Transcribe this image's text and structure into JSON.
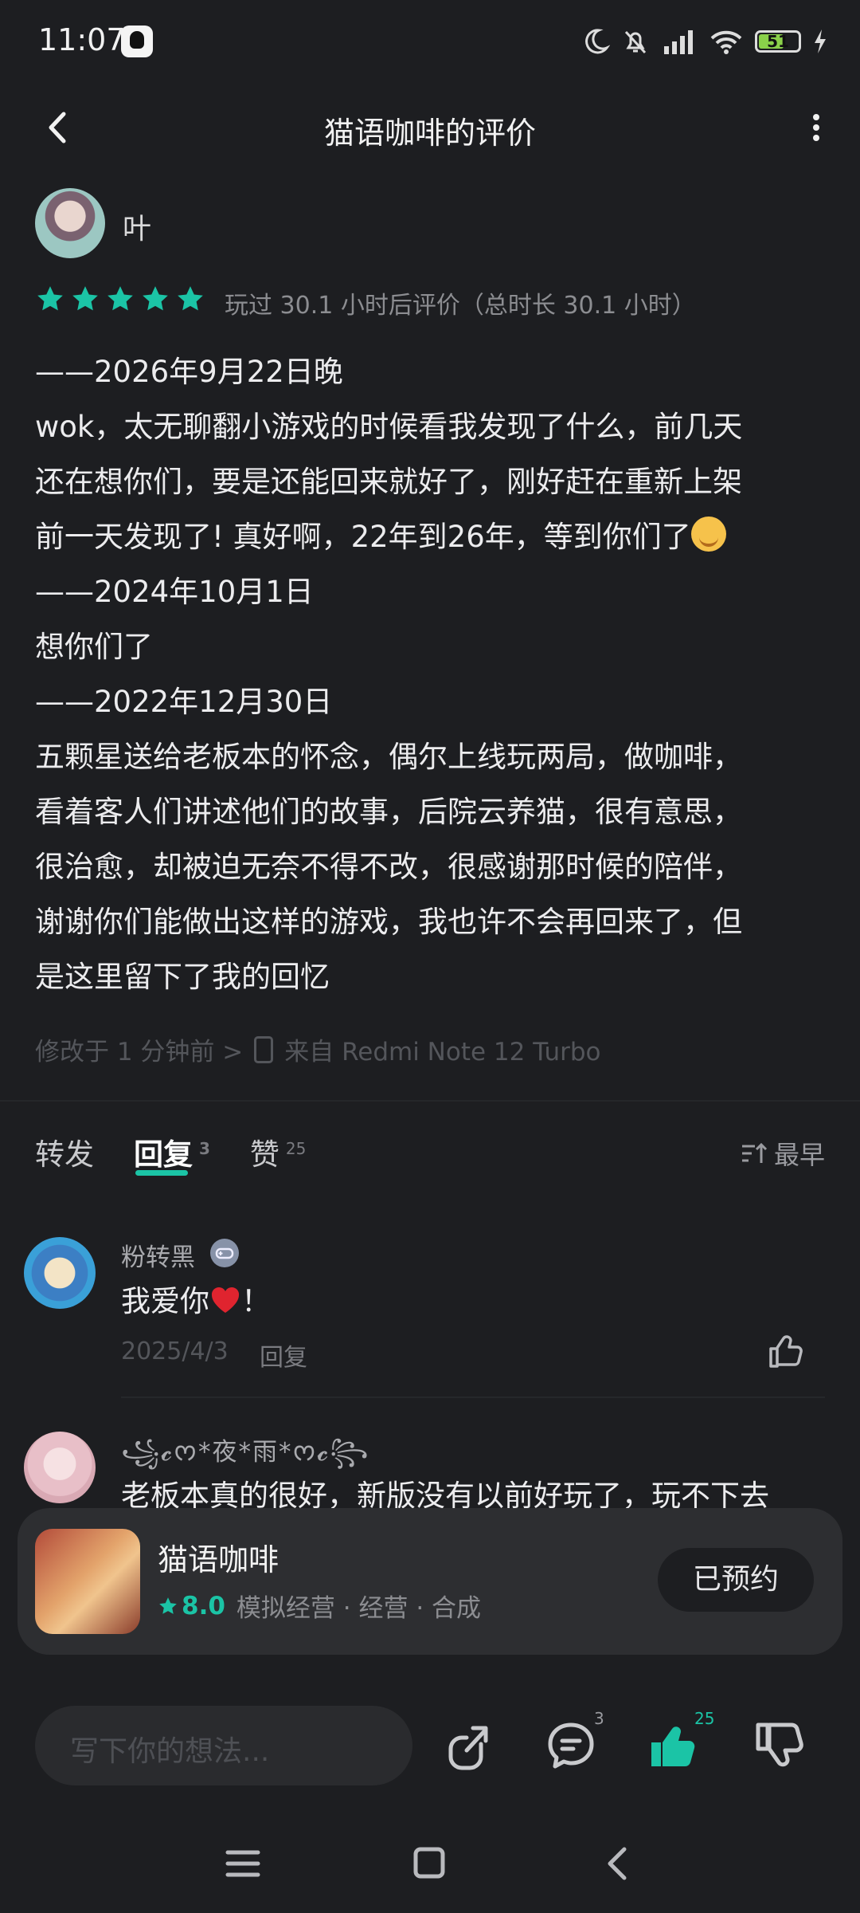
{
  "status_bar": {
    "time": "11:07",
    "battery": "51"
  },
  "header": {
    "title": "猫语咖啡的评价"
  },
  "review": {
    "user": "叶",
    "stars": 5,
    "playtime": "玩过 30.1 小时后评价（总时长 30.1 小时）",
    "lines": [
      "——2026年9月22日晚",
      "wok，太无聊翻小游戏的时候看我发现了什么，前几天",
      "还在想你们，要是还能回来就好了，刚好赶在重新上架",
      "前一天发现了! 真好啊，22年到26年，等到你们了",
      "——2024年10月1日",
      "想你们了",
      "——2022年12月30日",
      "五颗星送给老板本的怀念，偶尔上线玩两局，做咖啡，",
      "看着客人们讲述他们的故事，后院云养猫，很有意思，",
      "很治愈，却被迫无奈不得不改，很感谢那时候的陪伴，",
      "谢谢你们能做出这样的游戏，我也许不会再回来了，但",
      "是这里留下了我的回忆"
    ],
    "edited": "修改于 1 分钟前 >",
    "device": "来自 Redmi Note 12 Turbo"
  },
  "tabs": [
    {
      "label": "转发",
      "count": ""
    },
    {
      "label": "回复",
      "count": "3"
    },
    {
      "label": "赞",
      "count": "25"
    }
  ],
  "sort_label": "最早",
  "comments": [
    {
      "user": "粉转黑",
      "text": "我爱你",
      "text_suffix": "！",
      "date": "2025/4/3",
      "reply_label": "回复"
    },
    {
      "user": "꧁𝓬ᰔ*夜*雨*ᰔ𝓬꧂",
      "text": "老板本真的很好，新版没有以前好玩了，玩不下去"
    }
  ],
  "game_card": {
    "name": "猫语咖啡",
    "rating": "8.0",
    "tags": "模拟经营 · 经营 · 合成",
    "button": "已预约"
  },
  "bottom_bar": {
    "placeholder": "写下你的想法...",
    "reply_count": "3",
    "like_count": "25"
  },
  "colors": {
    "accent": "#1bc4a6",
    "background": "#1d1e21",
    "card": "#2d2e31"
  }
}
